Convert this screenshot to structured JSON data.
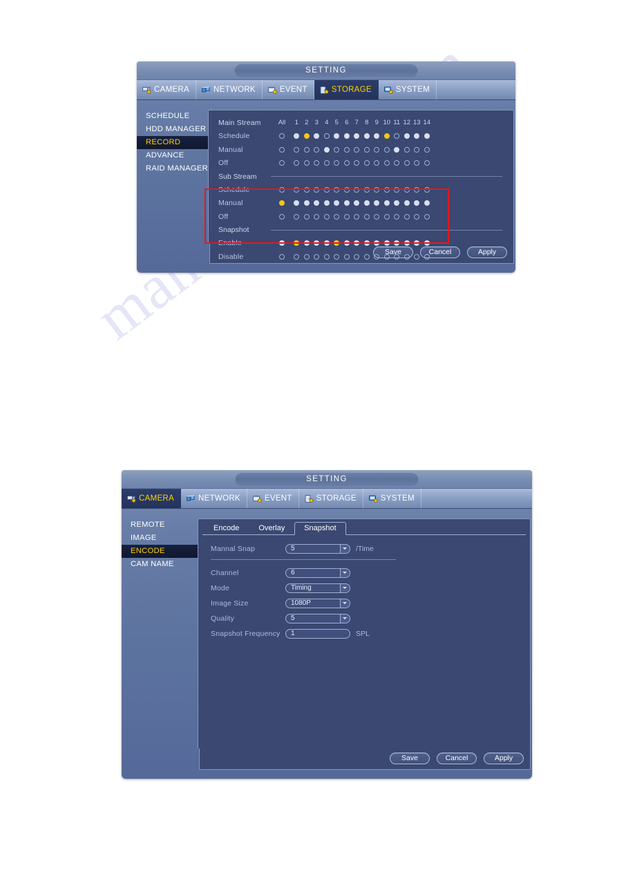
{
  "watermark": {
    "text": "manualshive.com"
  },
  "dialog1": {
    "title": "SETTING",
    "tabs": [
      {
        "label": "CAMERA",
        "icon": "camera-icon",
        "active": false
      },
      {
        "label": "NETWORK",
        "icon": "network-icon",
        "active": false
      },
      {
        "label": "EVENT",
        "icon": "event-icon",
        "active": false
      },
      {
        "label": "STORAGE",
        "icon": "storage-icon",
        "active": true
      },
      {
        "label": "SYSTEM",
        "icon": "system-icon",
        "active": false
      }
    ],
    "sidebar": [
      {
        "label": "SCHEDULE",
        "active": false
      },
      {
        "label": "HDD MANAGER",
        "active": false
      },
      {
        "label": "RECORD",
        "active": true
      },
      {
        "label": "ADVANCE",
        "active": false
      },
      {
        "label": "RAID MANAGER",
        "active": false
      }
    ],
    "channel_headers": [
      "1",
      "2",
      "3",
      "4",
      "5",
      "6",
      "7",
      "8",
      "9",
      "10",
      "11",
      "12",
      "13",
      "14"
    ],
    "all_label": "All",
    "groups": [
      {
        "name": "Main Stream",
        "is_header_row": true,
        "rows": [
          {
            "label": "Schedule",
            "all": "off",
            "channels": [
              "on",
              "yellow",
              "on",
              "off",
              "on",
              "on",
              "on",
              "on",
              "on",
              "yellow",
              "off",
              "on",
              "on",
              "on"
            ]
          },
          {
            "label": "Manual",
            "all": "off",
            "channels": [
              "off",
              "off",
              "off",
              "on",
              "off",
              "off",
              "off",
              "off",
              "off",
              "off",
              "on",
              "off",
              "off",
              "off"
            ]
          },
          {
            "label": "Off",
            "all": "off",
            "channels": [
              "off",
              "off",
              "off",
              "off",
              "off",
              "off",
              "off",
              "off",
              "off",
              "off",
              "off",
              "off",
              "off",
              "off"
            ]
          }
        ]
      },
      {
        "name": "Sub Stream",
        "is_header_row": false,
        "rows": [
          {
            "label": "Schedule",
            "all": "off",
            "channels": [
              "off",
              "off",
              "off",
              "off",
              "off",
              "off",
              "off",
              "off",
              "off",
              "off",
              "off",
              "off",
              "off",
              "off"
            ]
          },
          {
            "label": "Manual",
            "all": "yellow",
            "channels": [
              "on",
              "on",
              "on",
              "on",
              "on",
              "on",
              "on",
              "on",
              "on",
              "on",
              "on",
              "on",
              "on",
              "on"
            ]
          },
          {
            "label": "Off",
            "all": "off",
            "channels": [
              "off",
              "off",
              "off",
              "off",
              "off",
              "off",
              "off",
              "off",
              "off",
              "off",
              "off",
              "off",
              "off",
              "off"
            ]
          }
        ]
      },
      {
        "name": "Snapshot",
        "is_header_row": false,
        "highlighted": true,
        "rows": [
          {
            "label": "Enable",
            "all": "on",
            "channels": [
              "yellow",
              "on",
              "on",
              "on",
              "yellow",
              "on",
              "on",
              "on",
              "on",
              "on",
              "on",
              "on",
              "on",
              "on"
            ]
          },
          {
            "label": "Disable",
            "all": "off",
            "channels": [
              "off",
              "off",
              "off",
              "off",
              "off",
              "off",
              "off",
              "off",
              "off",
              "off",
              "off",
              "off",
              "off",
              "off"
            ]
          }
        ]
      }
    ],
    "buttons": {
      "save": "Save",
      "cancel": "Cancel",
      "apply": "Apply"
    }
  },
  "dialog2": {
    "title": "SETTING",
    "tabs": [
      {
        "label": "CAMERA",
        "icon": "camera-icon",
        "active": true
      },
      {
        "label": "NETWORK",
        "icon": "network-icon",
        "active": false
      },
      {
        "label": "EVENT",
        "icon": "event-icon",
        "active": false
      },
      {
        "label": "STORAGE",
        "icon": "storage-icon",
        "active": false
      },
      {
        "label": "SYSTEM",
        "icon": "system-icon",
        "active": false
      }
    ],
    "sidebar": [
      {
        "label": "REMOTE",
        "active": false
      },
      {
        "label": "IMAGE",
        "active": false
      },
      {
        "label": "ENCODE",
        "active": true
      },
      {
        "label": "CAM NAME",
        "active": false
      }
    ],
    "subtabs": [
      {
        "label": "Encode",
        "active": false
      },
      {
        "label": "Overlay",
        "active": false
      },
      {
        "label": "Snapshot",
        "active": true
      }
    ],
    "form": {
      "manual_snap": {
        "label": "Mannal Snap",
        "value": "5",
        "suffix": "/Time",
        "type": "select"
      },
      "channel": {
        "label": "Channel",
        "value": "6",
        "suffix": "",
        "type": "select"
      },
      "mode": {
        "label": "Mode",
        "value": "Timing",
        "suffix": "",
        "type": "select"
      },
      "image_size": {
        "label": "Image Size",
        "value": "1080P",
        "suffix": "",
        "type": "select"
      },
      "quality": {
        "label": "Quality",
        "value": "5",
        "suffix": "",
        "type": "select"
      },
      "snapshot_frequency": {
        "label": "Snapshot Frequency",
        "value": "1",
        "suffix": "SPL",
        "type": "text"
      }
    },
    "buttons": {
      "save": "Save",
      "cancel": "Cancel",
      "apply": "Apply"
    }
  },
  "colors": {
    "accent_yellow": "#ffd200",
    "radio_on": "#d8def0",
    "radio_yellow": "#f5c518",
    "highlight_red": "#e8161b",
    "panel_bg": "#3a4872"
  }
}
